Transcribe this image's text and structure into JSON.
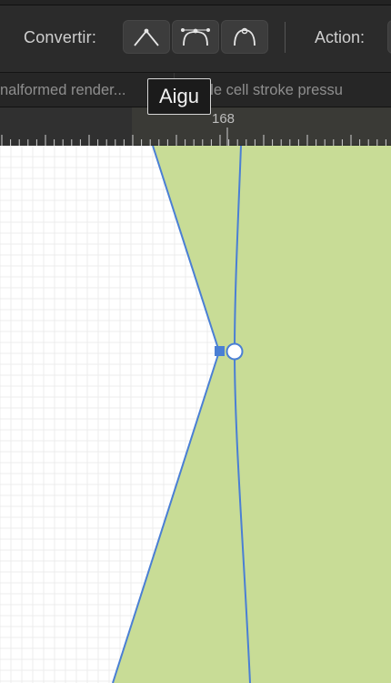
{
  "toolbar": {
    "convert_label": "Convertir:",
    "convert_buttons": [
      {
        "name": "sharp-corner-icon"
      },
      {
        "name": "smooth-node-icon"
      },
      {
        "name": "smart-node-icon"
      }
    ],
    "action_label": "Action:"
  },
  "tabs": [
    {
      "label": "nalformed render..."
    },
    {
      "label": "ble cell stroke pressu"
    }
  ],
  "ruler": {
    "label": "168"
  },
  "tooltip": {
    "text": "Aigu"
  },
  "colors": {
    "shape_fill": "#c8dc96",
    "path_stroke": "#4a7fd4",
    "grid_line": "#ececec"
  }
}
